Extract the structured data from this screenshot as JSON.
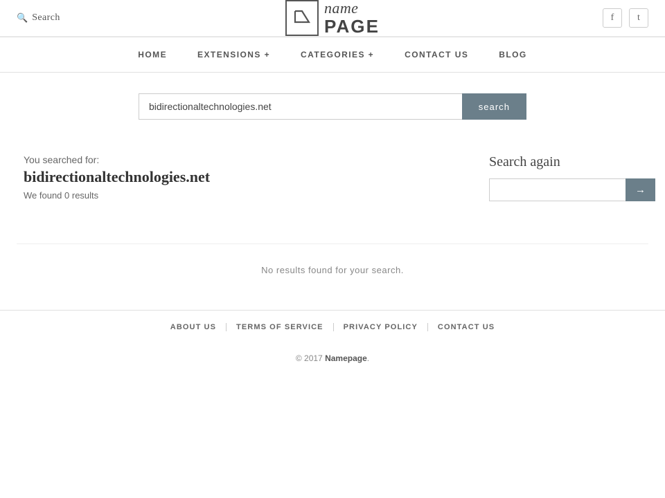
{
  "header": {
    "search_label": "Search",
    "social_facebook": "f",
    "social_twitter": "t"
  },
  "logo": {
    "name_text": "name",
    "page_text": "PAGE"
  },
  "nav": {
    "items": [
      {
        "label": "HOME",
        "id": "home"
      },
      {
        "label": "EXTENSIONS +",
        "id": "extensions"
      },
      {
        "label": "CATEGORIES +",
        "id": "categories"
      },
      {
        "label": "CONTACT US",
        "id": "contact"
      },
      {
        "label": "BLOG",
        "id": "blog"
      }
    ]
  },
  "search_bar": {
    "button_label": "search",
    "input_placeholder": ""
  },
  "results": {
    "you_searched_label": "You searched for:",
    "search_term": "bidirectionaltechnologies.net",
    "count_label": "We found 0 results",
    "no_results_text": "No results found for your search."
  },
  "search_again": {
    "title": "Search again",
    "button_label": "→",
    "input_placeholder": ""
  },
  "footer_nav": {
    "items": [
      {
        "label": "ABOUT US",
        "id": "about"
      },
      {
        "label": "TERMS OF SERVICE",
        "id": "terms"
      },
      {
        "label": "PRIVACY POLICY",
        "id": "privacy"
      },
      {
        "label": "CONTACT US",
        "id": "contact"
      }
    ]
  },
  "footer": {
    "copyright_prefix": "© 2017 ",
    "brand": "Namepage",
    "copyright_suffix": "."
  }
}
